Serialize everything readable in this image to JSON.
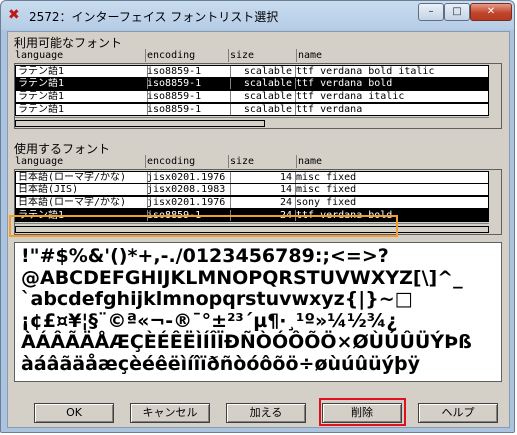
{
  "window": {
    "title": "2572：インターフェイス フォントリスト選択",
    "app_icon": "✖",
    "controls": {
      "minimize": "–",
      "maximize": "□",
      "close": "✕"
    }
  },
  "available": {
    "label": "利用可能なフォント",
    "columns": {
      "language": "language",
      "encoding": "encoding",
      "size": "size",
      "name": "name"
    },
    "rows": [
      {
        "language": "ラテン語1",
        "encoding": "iso8859-1",
        "size": "scalable",
        "name": "ttf verdana bold italic",
        "selected": false
      },
      {
        "language": "ラテン語1",
        "encoding": "iso8859-1",
        "size": "scalable",
        "name": "ttf verdana bold",
        "selected": true
      },
      {
        "language": "ラテン語1",
        "encoding": "iso8859-1",
        "size": "scalable",
        "name": "ttf verdana italic",
        "selected": false
      },
      {
        "language": "ラテン語1",
        "encoding": "iso8859-1",
        "size": "scalable",
        "name": "ttf verdana",
        "selected": false
      }
    ]
  },
  "used": {
    "label": "使用するフォント",
    "columns": {
      "language": "language",
      "encoding": "encoding",
      "size": "size",
      "name": "name"
    },
    "rows": [
      {
        "language": "日本語(ローマ字/かな)",
        "encoding": "jisx0201.1976-",
        "size": "14",
        "name": "misc fixed",
        "selected": false
      },
      {
        "language": "日本語(JIS)",
        "encoding": "jisx0208.1983-",
        "size": "14",
        "name": "misc fixed",
        "selected": false
      },
      {
        "language": "日本語(ローマ字/かな)",
        "encoding": "jisx0201.1976-",
        "size": "24",
        "name": "sony fixed",
        "selected": false
      },
      {
        "language": "ラテン語1",
        "encoding": "iso8859-1",
        "size": "24",
        "name": "ttf verdana bold",
        "selected": true
      }
    ]
  },
  "preview": {
    "lines": [
      " !\"#$%&'()*+,-./0123456789:;<=>?",
      "@ABCDEFGHIJKLMNOPQRSTUVWXYZ[\\]^_",
      "`abcdefghijklmnopqrstuvwxyz{|}~□",
      " ¡¢£¤¥¦§¨©ª«¬-®¯°±²³´µ¶·¸¹º»¼½¾¿",
      "ÀÁÂÃÄÅÆÇÈÉÊËÌÍÎÏÐÑÒÓÔÕÖ×ØÙÚÛÜÝÞß",
      "àáâãäåæçèéêëìíîïðñòóôõö÷øùúûüýþÿ"
    ]
  },
  "buttons": {
    "ok": "OK",
    "cancel": "キャンセル",
    "add": "加える",
    "delete": "削除",
    "help": "ヘルプ"
  },
  "highlight_colors": {
    "selection_box": "#f0a030",
    "delete_box": "#e01020"
  }
}
